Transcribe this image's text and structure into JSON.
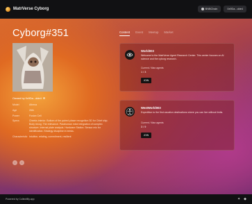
{
  "app": {
    "title": "MatrVerse Cyborg"
  },
  "header": {
    "network_label": "BNBChain",
    "wallet_label": "0x9Da...dde4"
  },
  "page": {
    "title": "Cyborg#351"
  },
  "owner": {
    "label": "Owned by 0x9Da...dde4"
  },
  "attributes": [
    {
      "key": "Model",
      "value": "Athena"
    },
    {
      "key": "Age",
      "value": "26th"
    },
    {
      "key": "Power",
      "value": "Fusion Cell"
    },
    {
      "key": "Specs",
      "value": "Cheeks interior. Bottom of the paired phase recognition 3D for Chief ship. Body recog. The relevance. Parahuman mind integration of complex structure. Internal plate analysis. Hardware Station. Sensor mix for identification. Strategy discipline in brinks."
    },
    {
      "key": "Characteristic",
      "value": "Intuitive, relating, commitment, resilient"
    }
  ],
  "tabs": [
    {
      "label": "Content",
      "active": true
    },
    {
      "label": "Event",
      "active": false
    },
    {
      "label": "Meetup",
      "active": false
    },
    {
      "label": "Market",
      "active": false
    }
  ],
  "worlds": [
    {
      "name": "World003",
      "description": "Welcome to the MatrVerse Agent Research Center. This center focuses on AI science and the cyborg research.",
      "capacity_label": "Current / Max agents",
      "capacity_value": "1 / 3",
      "join_label": "JOIN",
      "icon": "eye-icon"
    },
    {
      "name": "WestWorld003",
      "description": "Expedition to the first vacation destinations where you can live without limits.",
      "capacity_label": "Current / Max agents",
      "capacity_value": "3 / 9",
      "join_label": "JOIN",
      "icon": "vitruvian-icon"
    }
  ],
  "footer": {
    "text": "Powered by CollectiBy.app"
  },
  "colors": {
    "accent": "#e06a22",
    "card_bg": "#7a1e1e",
    "topbar": "#111113"
  }
}
